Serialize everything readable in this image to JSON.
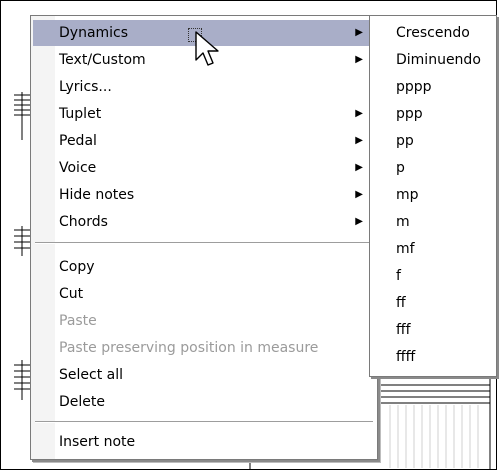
{
  "main_menu": {
    "items": [
      {
        "label": "Dynamics",
        "submenu": true,
        "highlighted": true,
        "disabled": false
      },
      {
        "label": "Text/Custom",
        "submenu": true,
        "highlighted": false,
        "disabled": false
      },
      {
        "label": "Lyrics...",
        "submenu": false,
        "highlighted": false,
        "disabled": false
      },
      {
        "label": "Tuplet",
        "submenu": true,
        "highlighted": false,
        "disabled": false
      },
      {
        "label": "Pedal",
        "submenu": true,
        "highlighted": false,
        "disabled": false
      },
      {
        "label": "Voice",
        "submenu": true,
        "highlighted": false,
        "disabled": false
      },
      {
        "label": "Hide notes",
        "submenu": true,
        "highlighted": false,
        "disabled": false
      },
      {
        "label": "Chords",
        "submenu": true,
        "highlighted": false,
        "disabled": false
      },
      {
        "label": "Copy",
        "submenu": false,
        "highlighted": false,
        "disabled": false
      },
      {
        "label": "Cut",
        "submenu": false,
        "highlighted": false,
        "disabled": false
      },
      {
        "label": "Paste",
        "submenu": false,
        "highlighted": false,
        "disabled": true
      },
      {
        "label": "Paste preserving position in measure",
        "submenu": false,
        "highlighted": false,
        "disabled": true
      },
      {
        "label": "Select all",
        "submenu": false,
        "highlighted": false,
        "disabled": false
      },
      {
        "label": "Delete",
        "submenu": false,
        "highlighted": false,
        "disabled": false
      },
      {
        "label": "Insert note",
        "submenu": false,
        "highlighted": false,
        "disabled": false
      }
    ],
    "submenu_arrow": "▶"
  },
  "sub_menu": {
    "items": [
      "Crescendo",
      "Diminuendo",
      "pppp",
      "ppp",
      "pp",
      "p",
      "mp",
      "m",
      "mf",
      "f",
      "ff",
      "fff",
      "ffff"
    ]
  },
  "colors": {
    "highlight": "#a9aec8",
    "disabled_text": "#9b9b9b",
    "menu_border": "#7a7a7a"
  },
  "icons": {
    "cursor": "arrow-pointer-icon",
    "submenu_arrow": "triangle-right-icon"
  }
}
